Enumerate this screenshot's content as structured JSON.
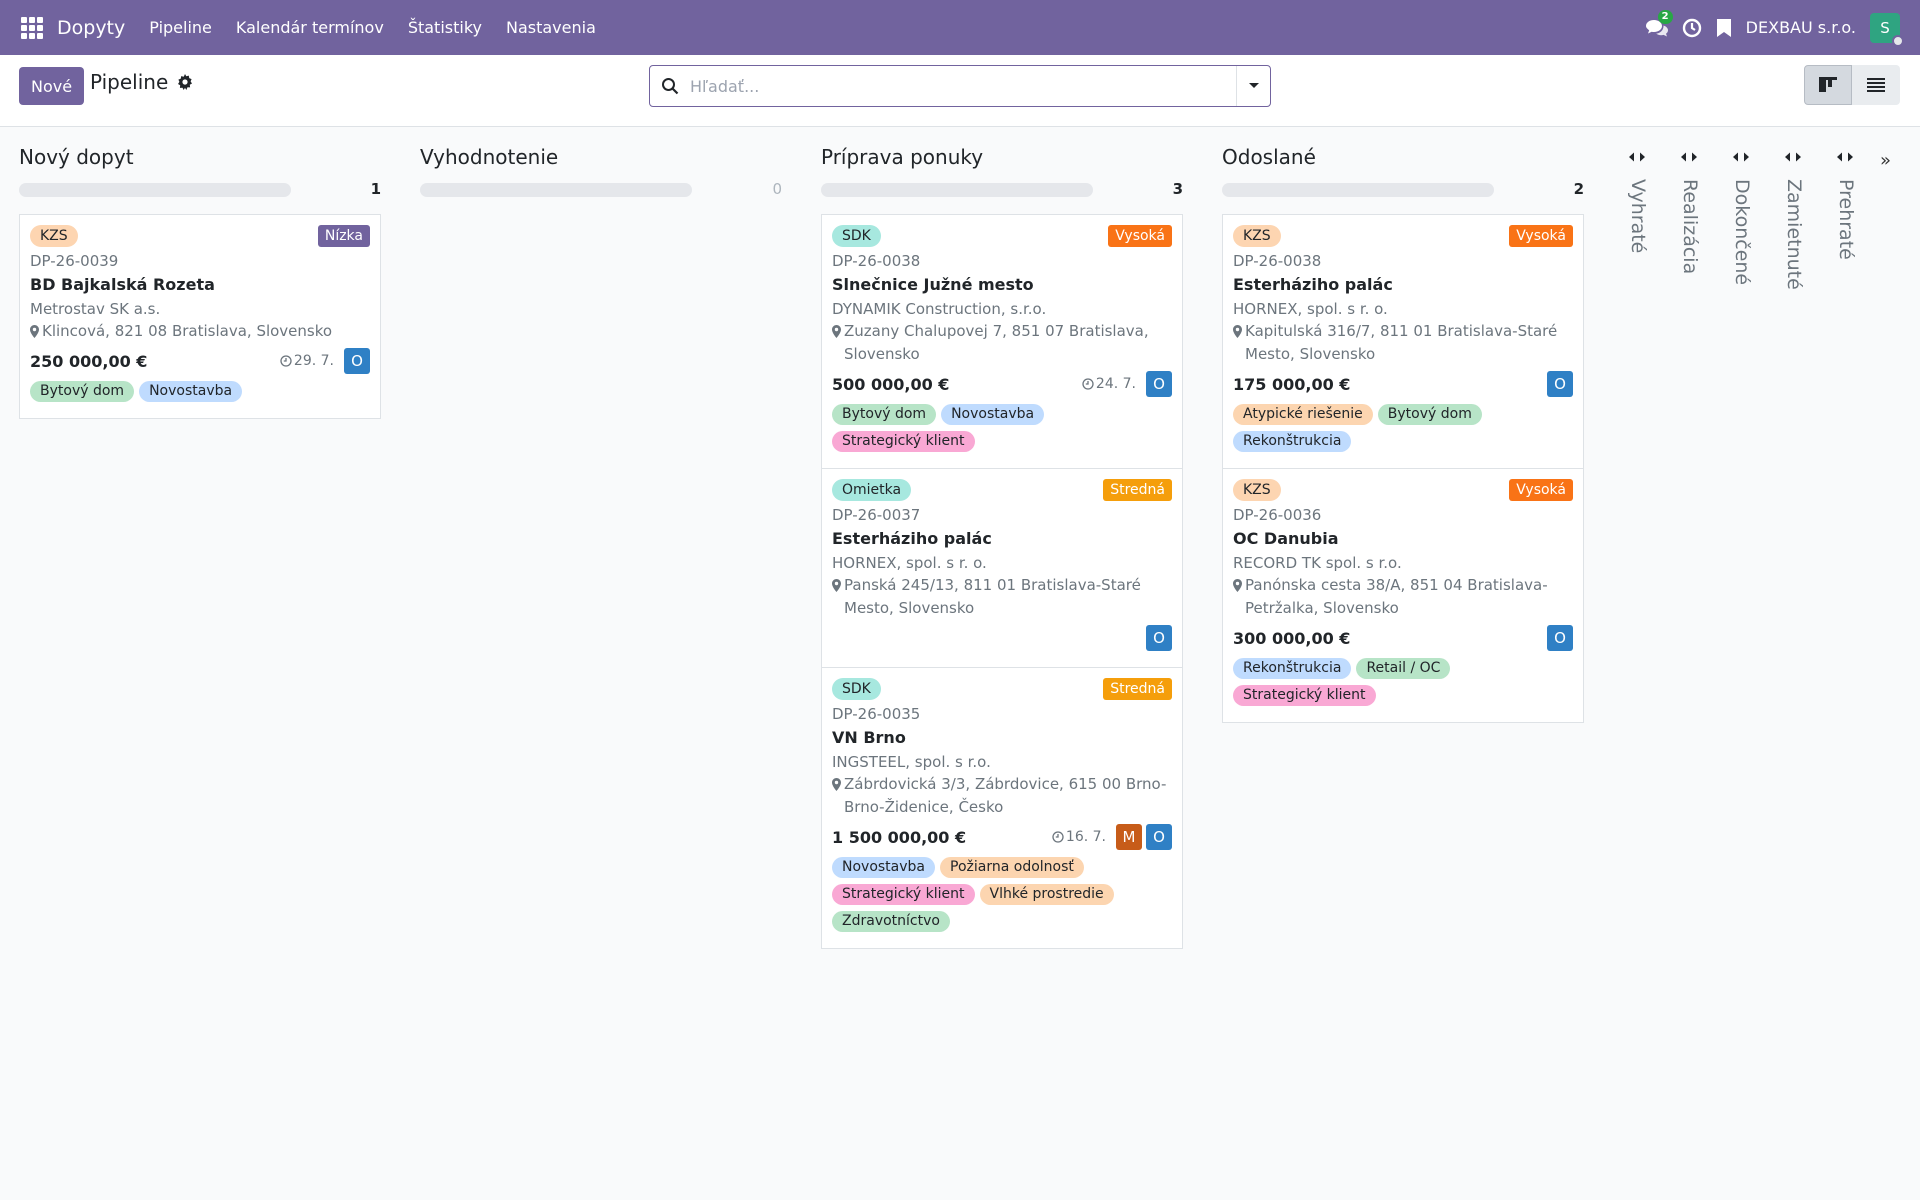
{
  "topbar": {
    "app_name": "Dopyty",
    "menu": [
      "Pipeline",
      "Kalendár termínov",
      "Štatistiky",
      "Nastavenia"
    ],
    "messages_count": "2",
    "company": "DEXBAU s.r.o.",
    "user_initial": "S"
  },
  "control": {
    "new_label": "Nové",
    "title": "Pipeline",
    "search_placeholder": "Hľadať..."
  },
  "colors": {
    "brand": "#71639e",
    "prio_high": "#f97316",
    "prio_mid": "#f59e0b",
    "prio_low": "#71639e",
    "user_o": "#2f80c5",
    "user_m": "#c75c19"
  },
  "columns": [
    {
      "title": "Nový dopyt",
      "count": "1",
      "cards": [
        {
          "category": "KZS",
          "priority": "Nízka",
          "ref": "DP-26-0039",
          "name": "BD Bajkalská Rozeta",
          "customer": "Metrostav SK a.s.",
          "address": "Klincová, 821 08 Bratislava, Slovensko",
          "amount": "250 000,00 €",
          "deadline": "29. 7.",
          "users": [
            "O"
          ],
          "tags": [
            "Bytový dom",
            "Novostavba"
          ]
        }
      ]
    },
    {
      "title": "Vyhodnotenie",
      "count": "0",
      "cards": []
    },
    {
      "title": "Príprava ponuky",
      "count": "3",
      "cards": [
        {
          "category": "SDK",
          "priority": "Vysoká",
          "ref": "DP-26-0038",
          "name": "Slnečnice Južné mesto",
          "customer": "DYNAMIK Construction, s.r.o.",
          "address": "Zuzany Chalupovej 7, 851 07 Bratislava, Slovensko",
          "amount": "500 000,00 €",
          "deadline": "24. 7.",
          "users": [
            "O"
          ],
          "tags": [
            "Bytový dom",
            "Novostavba",
            "Strategický klient"
          ]
        },
        {
          "category": "Omietka",
          "priority": "Stredná",
          "ref": "DP-26-0037",
          "name": "Esterháziho palác",
          "customer": "HORNEX, spol. s r. o.",
          "address": "Panská 245/13, 811 01 Bratislava-Staré Mesto, Slovensko",
          "amount": "",
          "deadline": "",
          "users": [
            "O"
          ],
          "tags": []
        },
        {
          "category": "SDK",
          "priority": "Stredná",
          "ref": "DP-26-0035",
          "name": "VN Brno",
          "customer": "INGSTEEL, spol. s r.o.",
          "address": "Zábrdovická 3/3, Zábrdovice, 615 00 Brno-Brno-Židenice, Česko",
          "amount": "1 500 000,00 €",
          "deadline": "16. 7.",
          "users": [
            "M",
            "O"
          ],
          "tags": [
            "Novostavba",
            "Požiarna odolnosť",
            "Strategický klient",
            "Vlhké prostredie",
            "Zdravotníctvo"
          ]
        }
      ]
    },
    {
      "title": "Odoslané",
      "count": "2",
      "cards": [
        {
          "category": "KZS",
          "priority": "Vysoká",
          "ref": "DP-26-0038",
          "name": "Esterháziho palác",
          "customer": "HORNEX, spol. s r. o.",
          "address": "Kapitulská 316/7, 811 01 Bratislava-Staré Mesto, Slovensko",
          "amount": "175 000,00 €",
          "deadline": "",
          "users": [
            "O"
          ],
          "tags": [
            "Atypické riešenie",
            "Bytový dom",
            "Rekonštrukcia"
          ]
        },
        {
          "category": "KZS",
          "priority": "Vysoká",
          "ref": "DP-26-0036",
          "name": "OC Danubia",
          "customer": "RECORD TK spol. s r.o.",
          "address": "Panónska cesta 38/A, 851 04 Bratislava-Petržalka, Slovensko",
          "amount": "300 000,00 €",
          "deadline": "",
          "users": [
            "O"
          ],
          "tags": [
            "Rekonštrukcia",
            "Retail / OC",
            "Strategický klient"
          ]
        }
      ]
    }
  ],
  "folded_columns": [
    "Vyhraté",
    "Realizácia",
    "Dokončené",
    "Zamietnuté",
    "Prehraté"
  ],
  "expand_all": "»"
}
